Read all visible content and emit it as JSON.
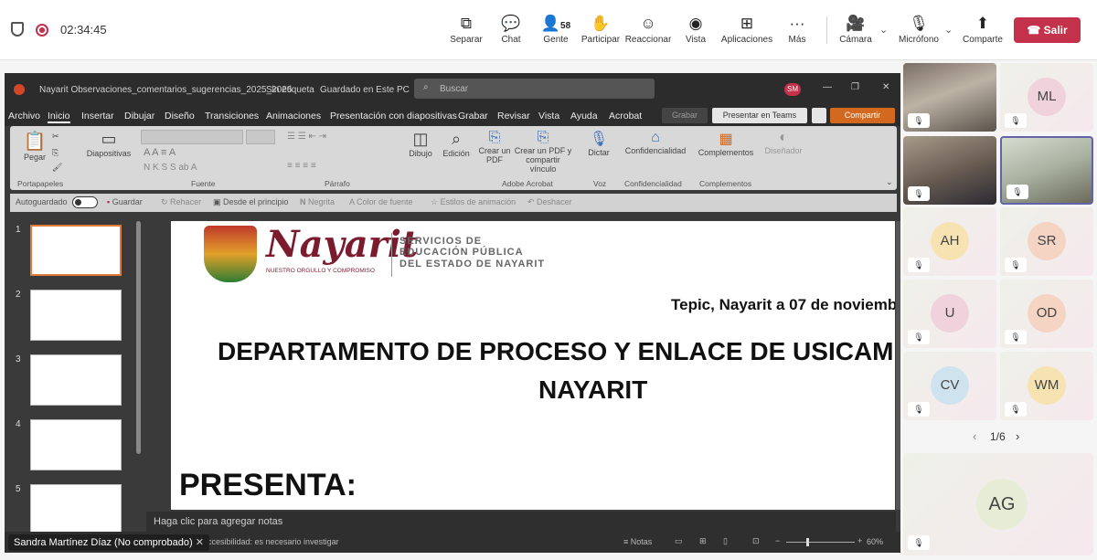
{
  "topbar": {
    "timer": "02:34:45",
    "people_count": "58",
    "buttons": {
      "separar": "Separar",
      "chat": "Chat",
      "gente": "Gente",
      "participar": "Participar",
      "reaccionar": "Reaccionar",
      "vista": "Vista",
      "aplicaciones": "Aplicaciones",
      "mas": "Más",
      "camara": "Cámara",
      "microfono": "Micrófono",
      "comparte": "Comparte",
      "salir": "Salir"
    }
  },
  "ppt": {
    "file_title": "Nayarit Observaciones_comentarios_sugerencias_2025_2026",
    "sensitivity": "Sin etiqueta",
    "saved_status": "Guardado en Este PC",
    "search_placeholder": "Buscar",
    "user_initials": "SM",
    "menu": [
      "Archivo",
      "Inicio",
      "Insertar",
      "Dibujar",
      "Diseño",
      "Transiciones",
      "Animaciones",
      "Presentación con diapositivas",
      "Grabar",
      "Revisar",
      "Vista",
      "Ayuda",
      "Acrobat"
    ],
    "grabar_btn": "Grabar",
    "present_teams_btn": "Presentar en Teams",
    "share_btn": "Compartir",
    "ribbon": {
      "pegar": "Pegar",
      "diapositivas": "Diapositivas",
      "dibujo": "Dibujo",
      "edicion": "Edición",
      "crear_pdf": "Crear un PDF",
      "crear_pdf_vinculo": "Crear un PDF y compartir vínculo",
      "dictar": "Dictar",
      "confidencialidad": "Confidencialidad",
      "complementos": "Complementos",
      "disenador": "Diseñador",
      "group_portapapeles": "Portapapeles",
      "group_fuente": "Fuente",
      "group_parrafo": "Párrafo",
      "group_adobe": "Adobe Acrobat",
      "group_voz": "Voz",
      "group_confidencialidad": "Confidencialidad",
      "group_complementos": "Complementos"
    },
    "qat": {
      "autoguardado": "Autoguardado",
      "guardar": "Guardar",
      "rehacer": "Rehacer",
      "desde_principio": "Desde el principio",
      "negrita": "Negrita",
      "color_fuente": "Color de fuente",
      "estilos_animacion": "Estilos de animación",
      "deshacer": "Deshacer"
    },
    "slide_numbers": [
      "1",
      "2",
      "3",
      "4",
      "5"
    ],
    "slide": {
      "logo_text": "Nayarit",
      "logo_tagline": "NUESTRO ORGULLO Y COMPROMISO",
      "org_line1": "SERVICIOS DE",
      "org_line2": "EDUCACIÓN PÚBLICA",
      "org_line3": "DEL ESTADO DE NAYARIT",
      "date_line": "Tepic, Nayarit a 07 de noviemb",
      "heading_line1": "DEPARTAMENTO DE PROCESO Y ENLACE DE USICAM",
      "heading_line2": "NAYARIT",
      "presenta": "PRESENTA:"
    },
    "notes_placeholder": "Haga clic para agregar notas",
    "status_notes": "Notas",
    "zoom": "60%",
    "presenter_name": "Sandra Martínez Díaz (No comprobado)",
    "accessibility_text": "Accesibilidad: es necesario investigar"
  },
  "participants": {
    "tiles": [
      "ML",
      "AH",
      "SR",
      "U",
      "OD",
      "CV",
      "WM"
    ],
    "pager": "1/6",
    "self": "AG"
  }
}
